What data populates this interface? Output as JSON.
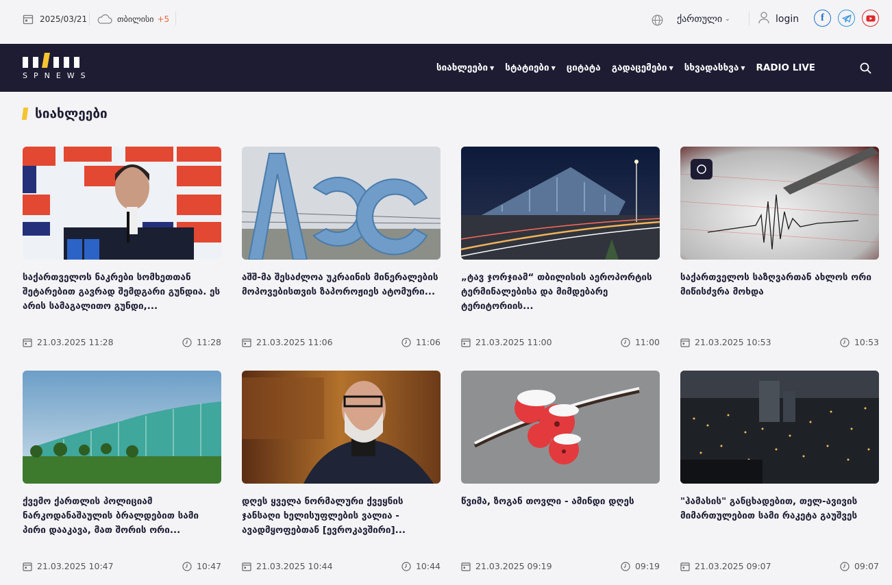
{
  "topbar": {
    "date": "2025/03/21",
    "city": "თბილისი",
    "temperature": "+5",
    "language": "ქართული",
    "login": "login"
  },
  "nav": {
    "logo_text": "SPNEWS",
    "items": [
      {
        "label": "სიახლეები",
        "dropdown": true
      },
      {
        "label": "სტატიები",
        "dropdown": true
      },
      {
        "label": "ციტატა",
        "dropdown": false
      },
      {
        "label": "გადაცემები",
        "dropdown": true
      },
      {
        "label": "სხვადასხვა",
        "dropdown": true
      },
      {
        "label": "RADIO LIVE",
        "dropdown": false
      }
    ]
  },
  "section": {
    "title": "სიახლეები"
  },
  "articles": [
    {
      "title": "საქართველოს ნაკრები სომხეთთან შეტარებით გავრად შემდგარი გუნდია. ეს არის სამაგალითო გუნდი,...",
      "date": "21.03.2025 11:28",
      "time": "11:28"
    },
    {
      "title": "აშშ-მა შესაძლოა უკრაინის მინერალების მოპოვებისთვის ზაპოროჟიეს ატომური...",
      "date": "21.03.2025 11:06",
      "time": "11:06"
    },
    {
      "title": "„ტავ ჯორჯიამ“ თბილისის აეროპორტის ტერმინალებისა და მიმდებარე ტერიტორიის...",
      "date": "21.03.2025 11:00",
      "time": "11:00"
    },
    {
      "title": "საქართველოს საზღვართან ახლოს ორი მიწისძვრა მოხდა",
      "date": "21.03.2025 10:53",
      "time": "10:53"
    },
    {
      "title": "ქვემო ქართლის პოლიციამ ნარკოდანაშაულის ბრალდებით სამი პირი დააკავა, მათ შორის ორი...",
      "date": "21.03.2025 10:47",
      "time": "10:47"
    },
    {
      "title": "დღეს ყველა ნორმალური ქვეყნის ჯანსაღი ხელისუფლების ვალია - ავადმყოფებთან [ევროკავშირი]...",
      "date": "21.03.2025 10:44",
      "time": "10:44"
    },
    {
      "title": "წვიმა, ზოგან თოვლი - ამინდი დღეს",
      "date": "21.03.2025 09:19",
      "time": "09:19"
    },
    {
      "title": "\"ჰამასის\" განცხადებით, თელ-ავივის მიმართულებით სამი რაკეტა გაუშვეს",
      "date": "21.03.2025 09:07",
      "time": "09:07"
    }
  ]
}
